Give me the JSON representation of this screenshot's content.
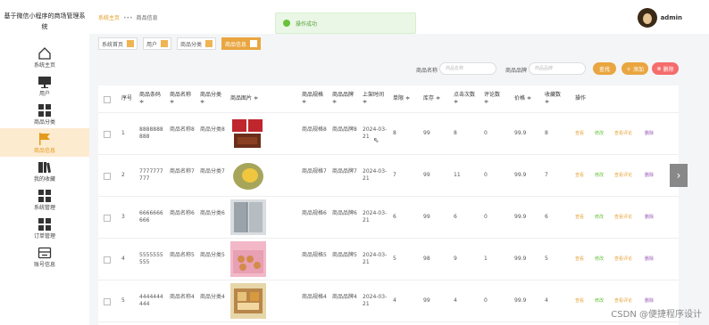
{
  "sidebar": {
    "brand": "基于微信小程序的商场管理系统",
    "items": [
      {
        "label": "系统主页",
        "icon": "home-icon",
        "active": false
      },
      {
        "label": "用户",
        "icon": "monitor-icon",
        "active": false
      },
      {
        "label": "商品分类",
        "icon": "grid-icon",
        "active": false
      },
      {
        "label": "商品信息",
        "icon": "flag-icon",
        "active": true
      },
      {
        "label": "我的收藏",
        "icon": "book-icon",
        "active": false
      },
      {
        "label": "系统管理",
        "icon": "grid-icon",
        "active": false
      },
      {
        "label": "订单管理",
        "icon": "grid-icon",
        "active": false
      },
      {
        "label": "账号信息",
        "icon": "card-icon",
        "active": false
      }
    ]
  },
  "topbar": {
    "crumb_home": "系统主页",
    "crumb_sep": "•••",
    "crumb_current": "商品信息",
    "toast": "操作成功",
    "username": "admin"
  },
  "tabs": [
    {
      "label": "系统首页"
    },
    {
      "label": "用户"
    },
    {
      "label": "商品分类"
    },
    {
      "label": "商品信息"
    }
  ],
  "search": {
    "name_label": "商品名称",
    "name_placeholder": "商品名称",
    "brand_label": "商品品牌",
    "brand_placeholder": "商品品牌",
    "search_btn": "查找",
    "add_btn": "添加",
    "delete_btn": "删除"
  },
  "table": {
    "headers": {
      "index": "序号",
      "code": "商品条码",
      "name": "商品名称",
      "category": "商品分类",
      "image": "商品图片",
      "spec": "商品规格",
      "brand": "商品品牌",
      "date": "上架时间",
      "unit": "单限",
      "stock": "库存",
      "clicks": "点击次数",
      "reviews": "评论数",
      "price": "价格",
      "favs": "收藏数",
      "ops": "操作"
    },
    "sort_mark": "≑",
    "actions": {
      "view": "查看",
      "edit": "修改",
      "review": "查看评论",
      "del": "删除"
    },
    "rows": [
      {
        "index": "1",
        "code": "8888888888",
        "name": "商品名称8",
        "category": "商品分类8",
        "spec": "商品规格8",
        "brand": "商品品牌8",
        "date": "2024-03-21",
        "unit": "8",
        "stock": "99",
        "clicks": "8",
        "reviews": "0",
        "price": "99.9",
        "favs": "8",
        "image": "chocolate"
      },
      {
        "index": "2",
        "code": "7777777777",
        "name": "商品名称7",
        "category": "商品分类7",
        "spec": "商品规格7",
        "brand": "商品品牌7",
        "date": "2024-03-21",
        "unit": "7",
        "stock": "99",
        "clicks": "11",
        "reviews": "0",
        "price": "99.9",
        "favs": "7",
        "image": "durian"
      },
      {
        "index": "3",
        "code": "6666666666",
        "name": "商品名称6",
        "category": "商品分类6",
        "spec": "商品规格6",
        "brand": "商品品牌6",
        "date": "2024-03-21",
        "unit": "6",
        "stock": "99",
        "clicks": "6",
        "reviews": "0",
        "price": "99.9",
        "favs": "6",
        "image": "fridge"
      },
      {
        "index": "4",
        "code": "5555555555",
        "name": "商品名称5",
        "category": "商品分类5",
        "spec": "商品规格5",
        "brand": "商品品牌5",
        "date": "2024-03-21",
        "unit": "5",
        "stock": "98",
        "clicks": "9",
        "reviews": "1",
        "price": "99.9",
        "favs": "5",
        "image": "mooncake"
      },
      {
        "index": "5",
        "code": "4444444444",
        "name": "商品名称4",
        "category": "商品分类4",
        "spec": "商品规格4",
        "brand": "商品品牌4",
        "date": "2024-03-21",
        "unit": "4",
        "stock": "99",
        "clicks": "4",
        "reviews": "0",
        "price": "99.9",
        "favs": "4",
        "image": "giftbox"
      }
    ]
  },
  "pager_arrow": "›",
  "watermark": "CSDN @便捷程序设计",
  "colors": {
    "accent": "#e9a640",
    "active_nav_bg": "#fdebd0",
    "success": "#67c23a",
    "danger": "#f56c6c",
    "view": "#e9a640",
    "edit": "#67c23a",
    "review": "#e9a640",
    "delete": "#9b59b6"
  }
}
